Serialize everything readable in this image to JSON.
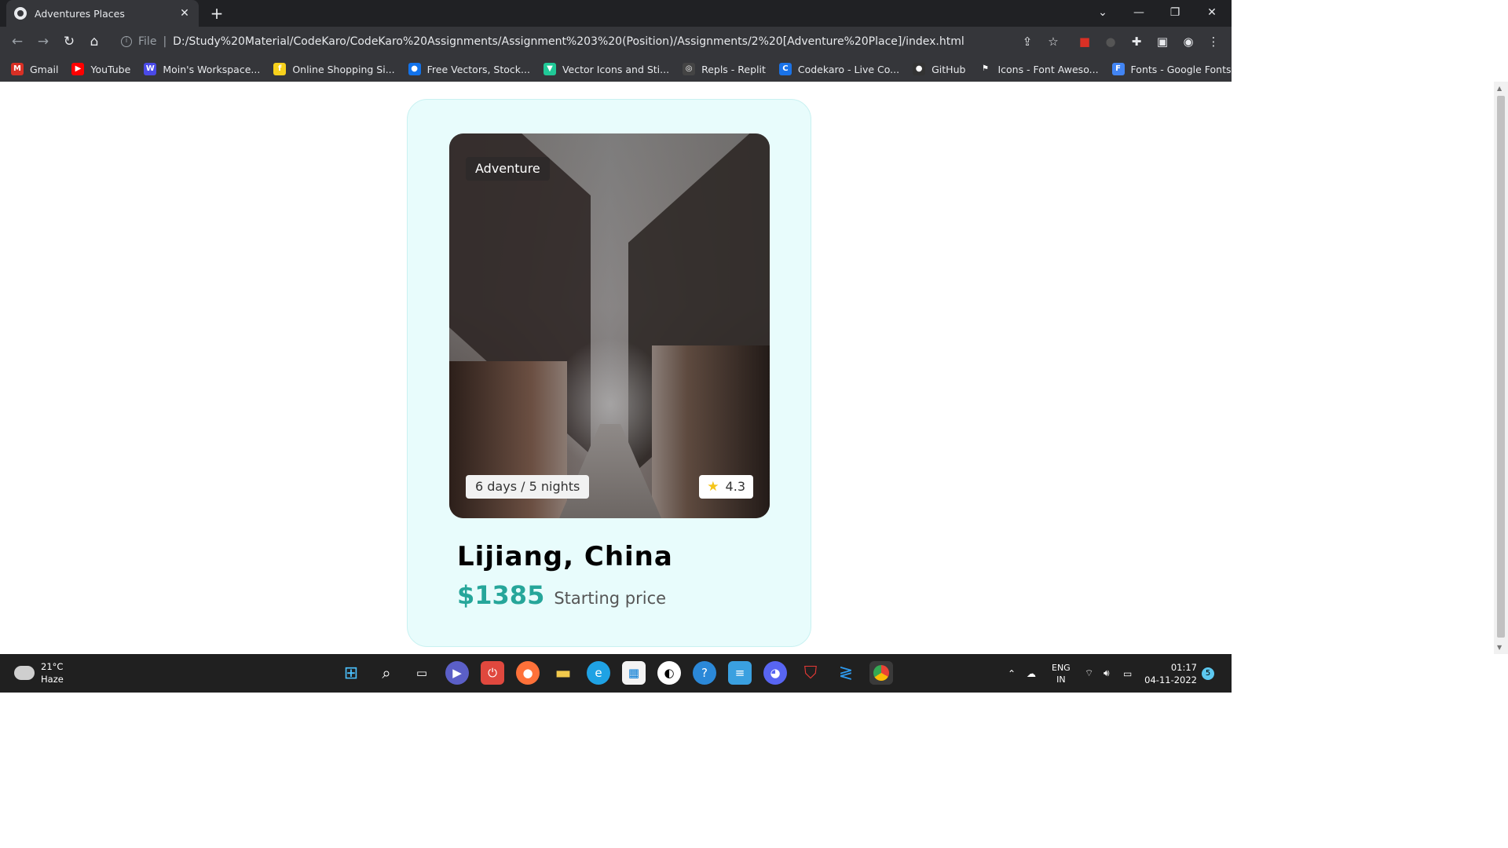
{
  "browser": {
    "tab_title": "Adventures Places",
    "tab_close": "✕",
    "new_tab": "+",
    "scheme": "File",
    "url": "D:/Study%20Material/CodeKaro/CodeKaro%20Assignments/Assignment%203%20(Position)/Assignments/2%20[Adventure%20Place]/index.html",
    "window_controls": [
      "⌄",
      "—",
      "❐",
      "✕"
    ]
  },
  "bookmarks": [
    {
      "label": "Gmail",
      "icon": "gmail-icon",
      "color": "#d93025",
      "glyph": "M"
    },
    {
      "label": "YouTube",
      "icon": "youtube-icon",
      "color": "#ff0000",
      "glyph": "▶"
    },
    {
      "label": "Moin's Workspace...",
      "icon": "workspace-icon",
      "color": "#4a4ae8",
      "glyph": "W"
    },
    {
      "label": "Online Shopping Si...",
      "icon": "flipkart-icon",
      "color": "#f7d11c",
      "glyph": "f"
    },
    {
      "label": "Free Vectors, Stock...",
      "icon": "freepik-icon",
      "color": "#1273eb",
      "glyph": "●"
    },
    {
      "label": "Vector Icons and Sti...",
      "icon": "flaticon-icon",
      "color": "#20c997",
      "glyph": "▼"
    },
    {
      "label": "Repls - Replit",
      "icon": "replit-icon",
      "color": "#444",
      "glyph": "◎"
    },
    {
      "label": "Codekaro - Live Co...",
      "icon": "codekaro-icon",
      "color": "#1a73e8",
      "glyph": "C"
    },
    {
      "label": "GitHub",
      "icon": "github-icon",
      "color": "#333",
      "glyph": "●"
    },
    {
      "label": "Icons - Font Aweso...",
      "icon": "fontawesome-icon",
      "color": "#35363a",
      "glyph": "⚑"
    },
    {
      "label": "Fonts - Google Fonts",
      "icon": "google-fonts-icon",
      "color": "#4285f4",
      "glyph": "F"
    }
  ],
  "card": {
    "category": "Adventure",
    "duration": "6 days / 5 nights",
    "rating": "4.3",
    "place": "Lijiang, China",
    "price": "$1385",
    "price_label": "Starting price"
  },
  "colors": {
    "card_bg": "#e8fcfc",
    "price": "#26a69a"
  },
  "taskbar": {
    "temperature": "21°C",
    "condition": "Haze",
    "lang": "ENG",
    "region": "IN",
    "time": "01:17",
    "date": "04-11-2022",
    "notifications": "5"
  }
}
